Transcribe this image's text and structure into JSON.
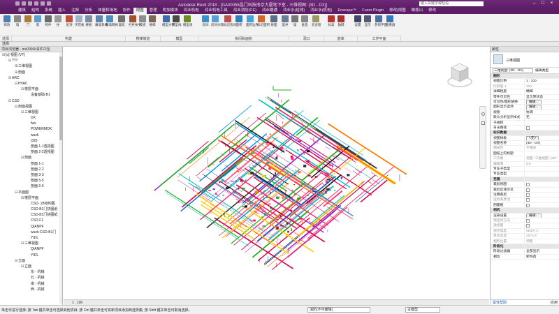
{
  "titlebar": {
    "title": "Autodesk Revit 2018 - [GA00058晶门科技南京大厦地下室 - 三维视图: {3D - DX}]",
    "search_placeholder": "键入关键字或短语",
    "minimize": "–",
    "maximize": "□",
    "close": "×"
  },
  "tabs": [
    "建筑",
    "结构",
    "系统",
    "插入",
    "注释",
    "分析",
    "体量和场地",
    "协作",
    "视图",
    "管理",
    "附加模块",
    "鸿业机电",
    "鸿业机电工具",
    "鸿业消防(CE)",
    "鸿业暖通",
    "鸿业水(给排)",
    "鸿业水(机电)",
    "Enscape™",
    "Fuzor Plugin",
    "修改|视图",
    "橄榄山",
    "修改"
  ],
  "active_tab": "视图",
  "ribbon": {
    "buttons": [
      "修改",
      "墙",
      "门",
      "窗",
      "构件",
      "柱",
      "屋顶",
      "天花板",
      "楼板",
      "幕墙系统",
      "幕墙网格",
      "竖梃",
      "栏杆扶手",
      "坡道",
      "楼梯",
      "模型文字",
      "模型线",
      "模型组",
      "房间",
      "房间分隔",
      "标记房间",
      "面积",
      "面积边界",
      "标记面积",
      "按面",
      "竖井",
      "墙",
      "垂直",
      "老虎窗",
      "标高",
      "轴网",
      "设置",
      "显示",
      "参照平面",
      "查看器"
    ],
    "panels": [
      "选择",
      "构建",
      "楼梯坡道",
      "模型",
      "房间和面积",
      "洞口",
      "基准",
      "工作平面"
    ]
  },
  "selbar": {
    "label": "选择"
  },
  "browser": {
    "title": "项目浏览器 - mx0000k事件中至",
    "tree": [
      {
        "level": 0,
        "toggle": "⊟",
        "label": "[o] 视图 (VT)"
      },
      {
        "level": 1,
        "toggle": "⊟",
        "label": "???"
      },
      {
        "level": 2,
        "toggle": "⊞",
        "label": "三维视图"
      },
      {
        "level": 2,
        "toggle": "⊞",
        "label": "剖面"
      },
      {
        "level": 1,
        "toggle": "⊟",
        "label": "ARC"
      },
      {
        "level": 2,
        "toggle": "⊟",
        "label": "HVAC"
      },
      {
        "level": 3,
        "toggle": "⊟",
        "label": "楼层平面"
      },
      {
        "level": 4,
        "toggle": "",
        "label": "设备基础-B1"
      },
      {
        "level": 1,
        "toggle": "⊟",
        "label": "CSD"
      },
      {
        "level": 2,
        "toggle": "⊟",
        "label": "剖面视图"
      },
      {
        "level": 3,
        "toggle": "⊟",
        "label": "三维视图"
      },
      {
        "level": 4,
        "toggle": "",
        "label": "DX"
      },
      {
        "level": 4,
        "toggle": "",
        "label": "fws"
      },
      {
        "level": 4,
        "toggle": "",
        "label": "POWERMOK"
      },
      {
        "level": 4,
        "toggle": "",
        "label": "wuzk"
      },
      {
        "level": 4,
        "toggle": "",
        "label": "{3D}"
      },
      {
        "level": 4,
        "toggle": "",
        "label": "剖面 1-1透视图"
      },
      {
        "level": 4,
        "toggle": "",
        "label": "剖面 2-2透视图"
      },
      {
        "level": 3,
        "toggle": "⊟",
        "label": "剖面"
      },
      {
        "level": 4,
        "toggle": "",
        "label": "剖面 1-1"
      },
      {
        "level": 4,
        "toggle": "",
        "label": "剖面 2-2"
      },
      {
        "level": 4,
        "toggle": "",
        "label": "剖面 3-3"
      },
      {
        "level": 4,
        "toggle": "",
        "label": "剖面 5-5"
      },
      {
        "level": 4,
        "toggle": "",
        "label": "剖面 6-6"
      },
      {
        "level": 2,
        "toggle": "⊟",
        "label": "平面图"
      },
      {
        "level": 3,
        "toggle": "⊟",
        "label": "楼层平面"
      },
      {
        "level": 4,
        "toggle": "",
        "label": "CSD- 1B结构图"
      },
      {
        "level": 4,
        "toggle": "",
        "label": "CSD-B1门拼图纸"
      },
      {
        "level": 4,
        "toggle": "",
        "label": "CSD-B1门拼图纸"
      },
      {
        "level": 4,
        "toggle": "",
        "label": "CSD-F1"
      },
      {
        "level": 4,
        "toggle": "",
        "label": "QIANPF"
      },
      {
        "level": 4,
        "toggle": "",
        "label": "wuzk-CSD-B1门"
      },
      {
        "level": 4,
        "toggle": "",
        "label": "YIDL"
      },
      {
        "level": 3,
        "toggle": "⊟",
        "label": "三维视图"
      },
      {
        "level": 4,
        "toggle": "",
        "label": "QIANPF"
      },
      {
        "level": 4,
        "toggle": "",
        "label": "YIDL"
      },
      {
        "level": 2,
        "toggle": "⊟",
        "label": "立面"
      },
      {
        "level": 3,
        "toggle": "⊟",
        "label": "立面"
      },
      {
        "level": 4,
        "toggle": "",
        "label": "东 - 机械"
      },
      {
        "level": 4,
        "toggle": "",
        "label": "北 - 机械"
      },
      {
        "level": 4,
        "toggle": "",
        "label": "南 - 机械"
      },
      {
        "level": 4,
        "toggle": "",
        "label": "西 - 机械"
      }
    ]
  },
  "viewctrl": {
    "scale": "1 : 100"
  },
  "props": {
    "title": "属性",
    "type_name": "三维视图",
    "selector": "三维视图: {3D - DX}",
    "edit_type": "编辑类型",
    "rows": [
      {
        "kind": "cat",
        "k": "图形",
        "v": ""
      },
      {
        "k": "视图比例",
        "v": "1 : 100"
      },
      {
        "k": "比例值 1:",
        "v": "100",
        "dim": true
      },
      {
        "k": "详细程度",
        "v": "精细"
      },
      {
        "k": "零件可见性",
        "v": "显示原状态"
      },
      {
        "k": "可见性/图形替换",
        "v": "编辑...",
        "btn": true
      },
      {
        "k": "图形显示选项",
        "v": "编辑...",
        "btn": true
      },
      {
        "k": "规程",
        "v": "协调"
      },
      {
        "k": "默认分析显示样式",
        "v": "无"
      },
      {
        "k": "子规程",
        "v": ""
      },
      {
        "k": "日光路径",
        "v": "",
        "cb": true
      },
      {
        "kind": "cat",
        "k": "标识数据",
        "v": ""
      },
      {
        "k": "视图样板",
        "v": "<无>",
        "btn": true
      },
      {
        "k": "视图名称",
        "v": "{3D - DX}"
      },
      {
        "k": "相关性",
        "v": "不相关",
        "dim": true
      },
      {
        "k": "图纸上的标题",
        "v": ""
      },
      {
        "k": "工作集",
        "v": "视图 \"三维视图: {3D\"",
        "dim": true
      },
      {
        "k": "编辑者",
        "v": "DX",
        "dim": true
      },
      {
        "k": "专业子类型",
        "v": ""
      },
      {
        "k": "专业类型",
        "v": ""
      },
      {
        "kind": "cat",
        "k": "范围",
        "v": ""
      },
      {
        "k": "裁剪视图",
        "v": "",
        "cb": true
      },
      {
        "k": "裁剪区域可见",
        "v": "",
        "cb": true
      },
      {
        "k": "注释裁剪",
        "v": "",
        "cb": true
      },
      {
        "k": "远剪裁激活",
        "v": "",
        "cb": true,
        "dim": true
      },
      {
        "k": "剖面框",
        "v": "",
        "cb": true
      },
      {
        "kind": "cat",
        "k": "相机",
        "v": ""
      },
      {
        "k": "渲染设置",
        "v": "编辑...",
        "btn": true
      },
      {
        "k": "锁定的方向",
        "v": "",
        "cb": true,
        "dim": true
      },
      {
        "k": "透视图",
        "v": "",
        "cb": true,
        "dim": true
      },
      {
        "k": "视点高度",
        "v": "98307.0",
        "dim": true
      },
      {
        "k": "目标高度",
        "v": "2573.9",
        "dim": true
      },
      {
        "k": "相机位置",
        "v": "调整",
        "dim": true
      },
      {
        "kind": "cat",
        "k": "阶段化",
        "v": ""
      },
      {
        "k": "阶段过滤器",
        "v": "全部显示"
      },
      {
        "k": "相位",
        "v": "新构造"
      }
    ],
    "help": "属性帮助",
    "apply": "应用"
  },
  "statusbar": {
    "hint": "单击可进行选择; 按 Tab 键并单击可选择其他项目; 按 Ctrl 键并单击可将新项目添加到选择集; 按 Shift 键并单击可取消选择。",
    "workset": "消防(不可编辑)",
    "model": "主模型"
  }
}
